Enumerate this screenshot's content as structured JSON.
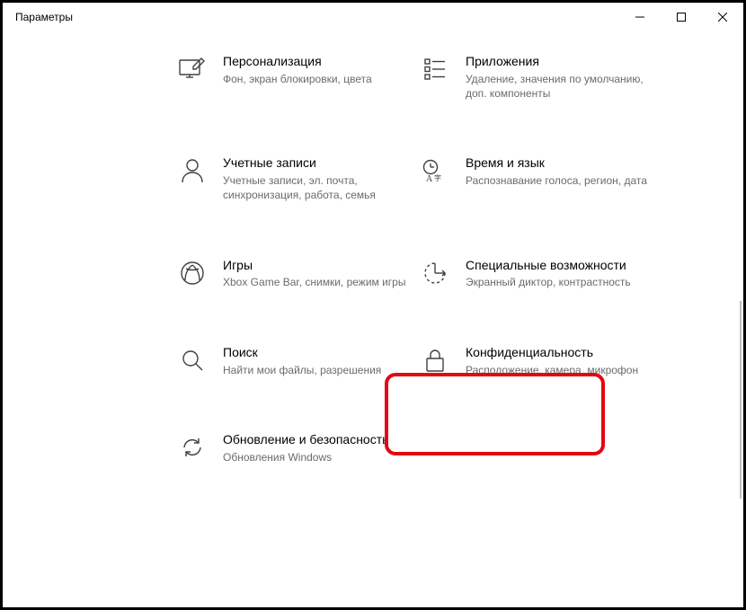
{
  "window": {
    "title": "Параметры"
  },
  "tiles": {
    "personalization": {
      "title": "Персонализация",
      "desc": "Фон, экран блокировки, цвета"
    },
    "apps": {
      "title": "Приложения",
      "desc": "Удаление, значения по умолчанию, доп. компоненты"
    },
    "accounts": {
      "title": "Учетные записи",
      "desc": "Учетные записи, эл. почта, синхронизация, работа, семья"
    },
    "time": {
      "title": "Время и язык",
      "desc": "Распознавание голоса, регион, дата"
    },
    "gaming": {
      "title": "Игры",
      "desc": "Xbox Game Bar, снимки, режим игры"
    },
    "ease": {
      "title": "Специальные возможности",
      "desc": "Экранный диктор, контрастность"
    },
    "search": {
      "title": "Поиск",
      "desc": "Найти мои файлы, разрешения"
    },
    "privacy": {
      "title": "Конфиденциальность",
      "desc": "Расположение, камера, микрофон"
    },
    "update": {
      "title": "Обновление и безопасность",
      "desc": "Обновления Windows"
    }
  }
}
